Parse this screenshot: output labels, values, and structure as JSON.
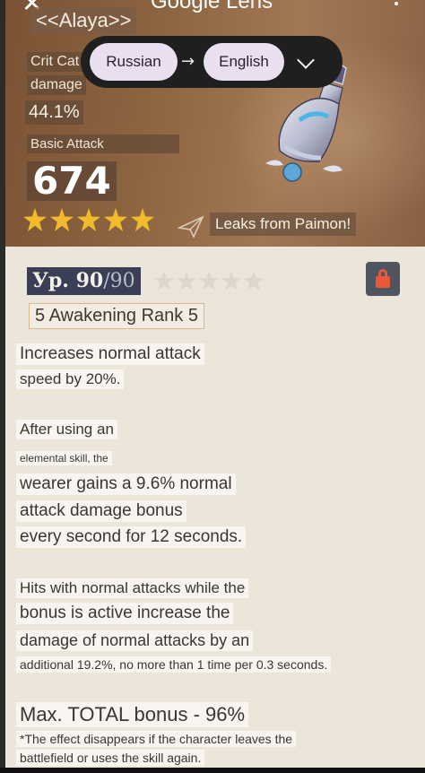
{
  "app": {
    "title": "Google Lens",
    "source_language": "Russian",
    "target_language": "English",
    "swap_arrow": "→"
  },
  "weapon": {
    "name": "<<Alaya>>",
    "secondary_stat_label_1": "Crit Cat",
    "secondary_stat_label_2": "damage",
    "secondary_stat_value": "44.1%",
    "basic_attack_label": "Basic Attack",
    "basic_attack_value": "674",
    "star_rating": 5,
    "leaks_text": "Leaks from Paimon!",
    "level_prefix": "Ур.",
    "level_current": "90",
    "level_max": "/90",
    "refinement_stars": 5,
    "awakening": "5 Awakening Rank 5"
  },
  "description": [
    "Increases normal attack",
    "speed by 20%.",
    "After using an",
    "elemental skill, the",
    "wearer gains a 9.6% normal",
    "attack damage bonus",
    "every second for 12 seconds.",
    "Hits with normal attacks while the",
    "bonus is active increase the",
    "damage of normal attacks by an",
    "additional 19.2%, no more than 1 time per 0.3 seconds.",
    "Max. TOTAL bonus - 96%",
    "*The effect disappears if the character leaves the",
    "battlefield or uses the skill again."
  ],
  "colors": {
    "star_gold": "#f1bb2c",
    "lock_red": "#e8593a",
    "level_badge": "#3a3f55"
  }
}
